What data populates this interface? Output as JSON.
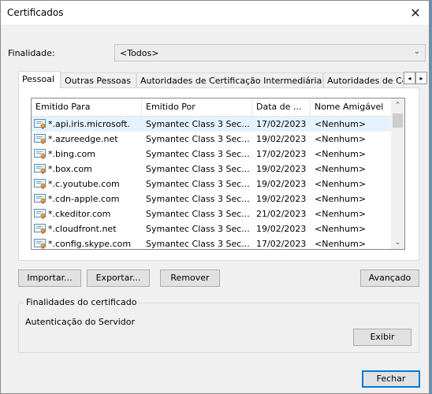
{
  "window": {
    "title": "Certificados",
    "close_glyph": "✕"
  },
  "finalidade": {
    "label": "Finalidade:",
    "selected": "<Todos>"
  },
  "tabs": [
    {
      "label": "Pessoal",
      "active": true
    },
    {
      "label": "Outras Pessoas"
    },
    {
      "label": "Autoridades de Certificação Intermediárias"
    },
    {
      "label": "Autoridades de Ce"
    }
  ],
  "tab_scroll": {
    "left": "◂",
    "right": "▸"
  },
  "list": {
    "columns": [
      "Emitido Para",
      "Emitido Por",
      "Data de ...",
      "Nome Amigável"
    ],
    "rows": [
      {
        "issued_to": "*.api.iris.microsoft.",
        "issued_by": "Symantec Class 3 Sec...",
        "date": "17/02/2023",
        "friendly": "<Nenhum>"
      },
      {
        "issued_to": "*.azureedge.net",
        "issued_by": "Symantec Class 3 Sec...",
        "date": "19/02/2023",
        "friendly": "<Nenhum>"
      },
      {
        "issued_to": "*.bing.com",
        "issued_by": "Symantec Class 3 Sec...",
        "date": "17/02/2023",
        "friendly": "<Nenhum>"
      },
      {
        "issued_to": "*.box.com",
        "issued_by": "Symantec Class 3 Sec...",
        "date": "19/02/2023",
        "friendly": "<Nenhum>"
      },
      {
        "issued_to": "*.c.youtube.com",
        "issued_by": "Symantec Class 3 Sec...",
        "date": "19/02/2023",
        "friendly": "<Nenhum>"
      },
      {
        "issued_to": "*.cdn-apple.com",
        "issued_by": "Symantec Class 3 Sec...",
        "date": "19/02/2023",
        "friendly": "<Nenhum>"
      },
      {
        "issued_to": "*.ckeditor.com",
        "issued_by": "Symantec Class 3 Sec...",
        "date": "21/02/2023",
        "friendly": "<Nenhum>"
      },
      {
        "issued_to": "*.cloudfront.net",
        "issued_by": "Symantec Class 3 Sec...",
        "date": "19/02/2023",
        "friendly": "<Nenhum>"
      },
      {
        "issued_to": "*.config.skype.com",
        "issued_by": "Symantec Class 3 Sec...",
        "date": "17/02/2023",
        "friendly": "<Nenhum>"
      }
    ],
    "selected_row": 0
  },
  "buttons": {
    "importar": "Importar...",
    "exportar": "Exportar...",
    "remover": "Remover",
    "avancado": "Avançado",
    "exibir": "Exibir",
    "fechar": "Fechar"
  },
  "finalidades_certificado": {
    "legend": "Finalidades do certificado",
    "value": "Autenticação do Servidor"
  },
  "icons": {
    "close": "close-icon",
    "dropdown": "chevron-down-icon",
    "certificate": "certificate-icon",
    "scroll_up": "chevron-up-icon",
    "scroll_down": "chevron-down-icon"
  }
}
